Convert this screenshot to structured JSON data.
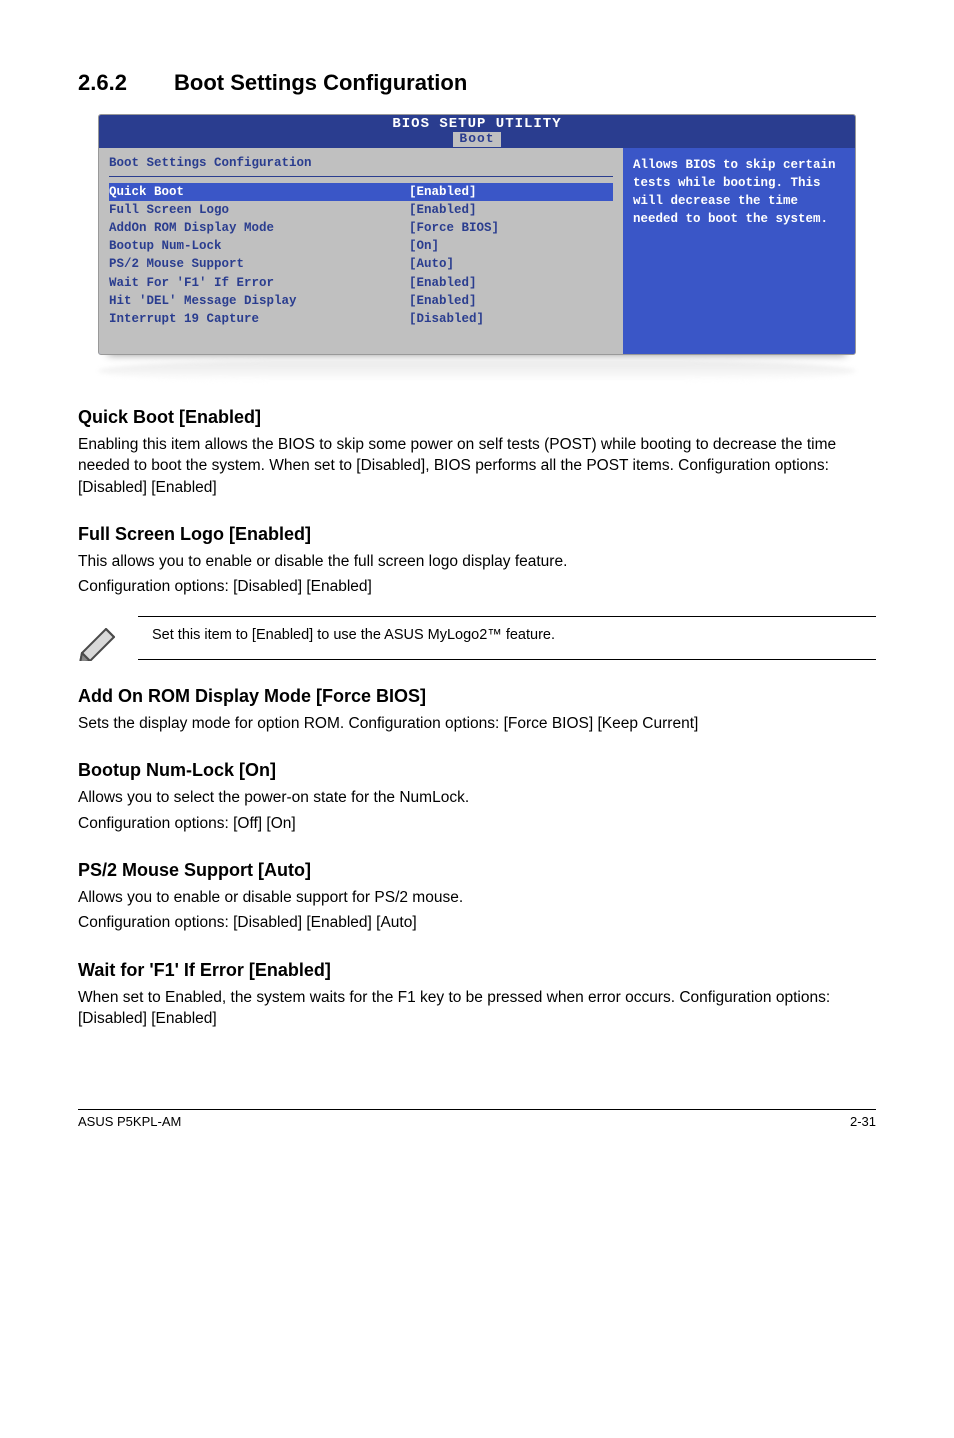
{
  "section": {
    "number": "2.6.2",
    "title": "Boot Settings Configuration"
  },
  "bios": {
    "utility_title": "BIOS SETUP UTILITY",
    "tab": "Boot",
    "panel_heading": "Boot Settings Configuration",
    "rows": [
      {
        "label": "Quick Boot",
        "value": "[Enabled]",
        "selected": true
      },
      {
        "label": "Full Screen Logo",
        "value": "[Enabled]"
      },
      {
        "label": "AddOn ROM Display Mode",
        "value": "[Force BIOS]"
      },
      {
        "label": "Bootup Num-Lock",
        "value": "[On]"
      },
      {
        "label": "PS/2 Mouse Support",
        "value": "[Auto]"
      },
      {
        "label": "Wait For 'F1' If Error",
        "value": "[Enabled]"
      },
      {
        "label": "Hit 'DEL' Message Display",
        "value": "[Enabled]"
      },
      {
        "label": "Interrupt 19 Capture",
        "value": "[Disabled]"
      }
    ],
    "help_text": "Allows BIOS to skip certain tests while booting. This will decrease the time needed to boot the system."
  },
  "sections": {
    "quick_boot": {
      "h": "Quick Boot [Enabled]",
      "p": "Enabling this item allows the BIOS to skip some power on self tests (POST) while booting to decrease the time needed to boot the system. When set to [Disabled], BIOS performs all the POST items. Configuration options: [Disabled] [Enabled]"
    },
    "full_screen_logo": {
      "h": "Full Screen Logo [Enabled]",
      "p1": "This allows you to enable or disable the full screen logo display feature.",
      "p2": "Configuration options: [Disabled] [Enabled]"
    },
    "note": "Set this item to [Enabled] to use the ASUS MyLogo2™ feature.",
    "addon_rom": {
      "h": "Add On ROM Display Mode [Force BIOS]",
      "p": "Sets the display mode for option ROM. Configuration options: [Force BIOS] [Keep Current]"
    },
    "numlock": {
      "h": "Bootup Num-Lock [On]",
      "p1": "Allows you to select the power-on state for the NumLock.",
      "p2": "Configuration options: [Off] [On]"
    },
    "ps2": {
      "h": "PS/2 Mouse Support [Auto]",
      "p1": "Allows you to enable or disable support for PS/2 mouse.",
      "p2": "Configuration options: [Disabled] [Enabled] [Auto]"
    },
    "wait_f1": {
      "h": "Wait for 'F1' If Error [Enabled]",
      "p": "When set to Enabled, the system waits for the F1 key to be pressed when error occurs. Configuration options: [Disabled] [Enabled]"
    }
  },
  "footer": {
    "left": "ASUS P5KPL-AM",
    "right": "2-31"
  }
}
